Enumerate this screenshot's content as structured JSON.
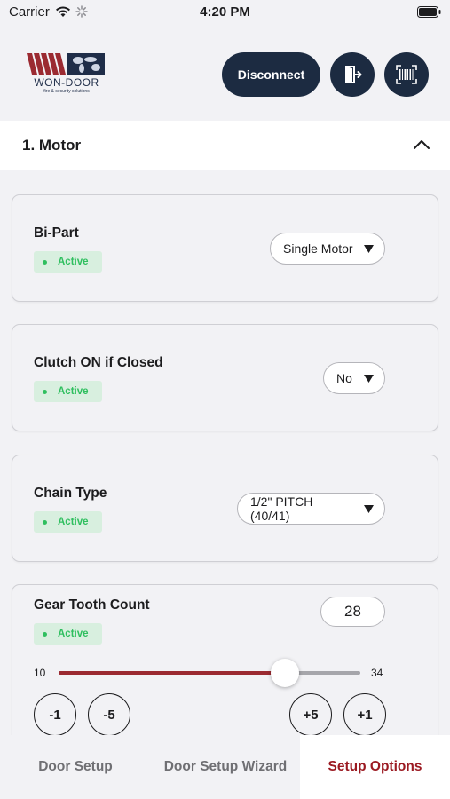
{
  "status_bar": {
    "carrier": "Carrier",
    "time": "4:20 PM"
  },
  "header": {
    "logo_text": "WON-DOOR",
    "logo_sub": "fire & security solutions",
    "disconnect_label": "Disconnect",
    "exit_icon": "exit-door-icon",
    "scan_icon": "barcode-scan-icon"
  },
  "section": {
    "title": "1. Motor",
    "expanded": true
  },
  "cards": {
    "bi_part": {
      "title": "Bi-Part",
      "status": "Active",
      "selected": "Single Motor"
    },
    "clutch": {
      "title": "Clutch ON if Closed",
      "status": "Active",
      "selected": "No"
    },
    "chain": {
      "title": "Chain Type",
      "status": "Active",
      "selected": "1/2\" PITCH (40/41)"
    },
    "gear": {
      "title": "Gear Tooth Count",
      "status": "Active",
      "value": "28",
      "min": "10",
      "max": "34",
      "current": 28,
      "steps": [
        "-1",
        "-5",
        "+5",
        "+1"
      ]
    }
  },
  "tabs": [
    {
      "label": "Door Setup",
      "active": false
    },
    {
      "label": "Door Setup Wizard",
      "active": false
    },
    {
      "label": "Setup Options",
      "active": true
    }
  ],
  "colors": {
    "navy": "#1c2b41",
    "accent_red": "#9b1a22",
    "active_green": "#2fbf5f"
  }
}
